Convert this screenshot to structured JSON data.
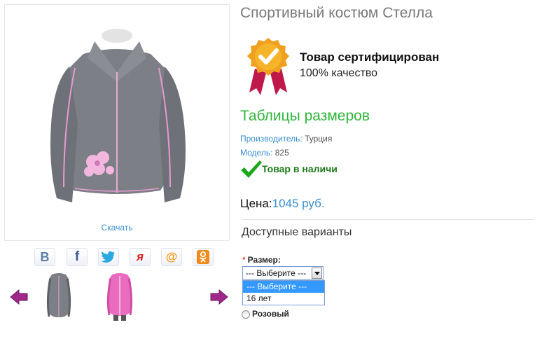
{
  "product": {
    "title": "Спортивный костюм Стелла",
    "download_label": "Скачать"
  },
  "certificate": {
    "title": "Товар сертифицирован",
    "subtitle": "100% качество",
    "icon": "certified-badge-icon",
    "badge_color": "#f0a020",
    "ribbon_color": "#c0184a"
  },
  "size_table_link": "Таблицы размеров",
  "details": {
    "manufacturer_label": "Производитель:",
    "manufacturer_value": "Турция",
    "model_label": "Модель:",
    "model_value": "825"
  },
  "stock": {
    "label": "Товар в наличи",
    "icon": "checkmark-icon"
  },
  "price": {
    "label": "Цена:",
    "value": "1045 руб."
  },
  "variants": {
    "heading": "Доступные варианты",
    "size": {
      "required_mark": "*",
      "label": "Размер:",
      "selected": "--- Выберите ---",
      "options": [
        "--- Выберите ---",
        "16 лет"
      ]
    },
    "color_option": "Розовый"
  },
  "share": {
    "buttons": [
      {
        "name": "vkontakte-icon",
        "glyph": "B",
        "color": "#5b7fa6"
      },
      {
        "name": "facebook-icon",
        "glyph": "f",
        "color": "#3b5998"
      },
      {
        "name": "twitter-icon",
        "glyph": "",
        "color": "#2aa9e0"
      },
      {
        "name": "yaru-icon",
        "glyph": "",
        "color": "#e02020"
      },
      {
        "name": "mailru-icon",
        "glyph": "@",
        "color": "#f39a1b"
      },
      {
        "name": "odnoklassniki-icon",
        "glyph": "",
        "color": "#f08b19"
      }
    ]
  },
  "colors": {
    "link_blue": "#3a8fd0",
    "green": "#2fb53a",
    "arrow_magenta": "#a0288a"
  }
}
